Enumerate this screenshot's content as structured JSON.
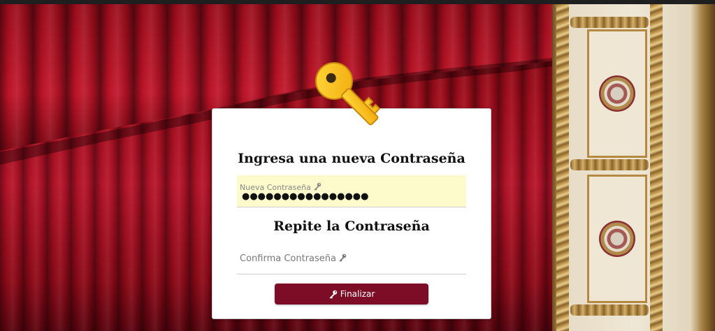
{
  "form": {
    "title_new": "Ingresa una nueva Contraseña",
    "new_password_label": "Nueva Contraseña",
    "new_password_value": "●●●●●●●●●●●●●●●●",
    "title_repeat": "Repite la Contraseña",
    "confirm_placeholder": "Confirma Contraseña",
    "submit_label": "Finalizar"
  },
  "icons": {
    "logo": "key-icon",
    "field_hint": "key-icon",
    "button": "key-icon"
  },
  "colors": {
    "button_bg": "#7d0c26",
    "filled_field_bg": "#fdfacb",
    "curtain": "#b8142a"
  }
}
